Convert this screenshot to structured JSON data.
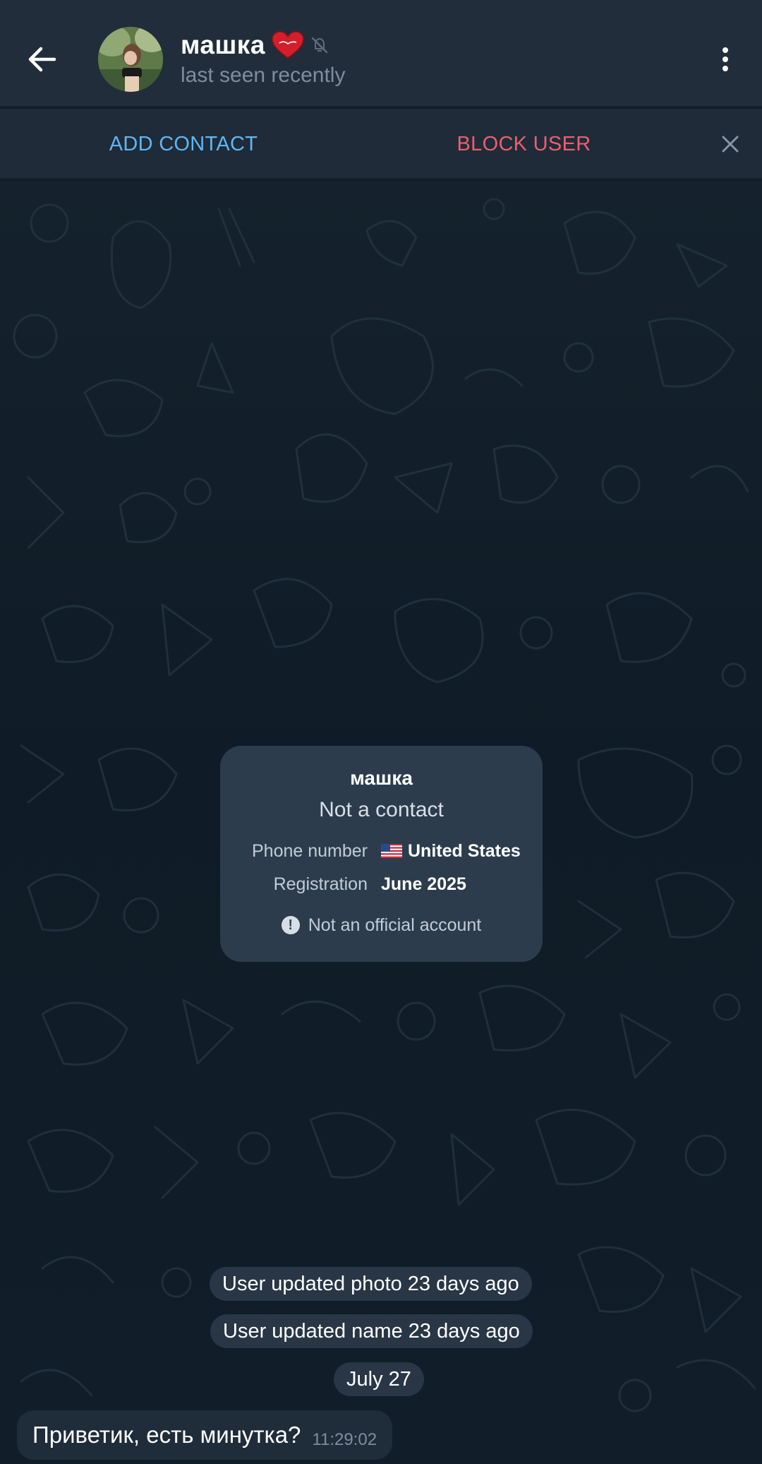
{
  "header": {
    "name": "машка",
    "status": "last seen recently",
    "icons": [
      "arrow-left-icon",
      "heart-emoji-icon",
      "muted-icon",
      "more-vertical-icon"
    ]
  },
  "action_bar": {
    "add_contact": "ADD CONTACT",
    "block_user": "BLOCK USER"
  },
  "info_card": {
    "name": "машка",
    "subtitle": "Not a contact",
    "phone_label": "Phone number",
    "phone_value": "United States",
    "registration_label": "Registration",
    "registration_value": "June 2025",
    "warning": "Not an official account"
  },
  "service_messages": {
    "photo_update": "User updated photo 23 days ago",
    "name_update": "User updated name 23 days ago",
    "date": "July 27"
  },
  "message": {
    "text": "Приветик, есть минутка?",
    "time": "11:29:02"
  },
  "colors": {
    "header_bg": "#212d3b",
    "accent_blue": "#5fb6f4",
    "danger_red": "#ec5f6c",
    "chat_bg": "#0f1b26"
  }
}
